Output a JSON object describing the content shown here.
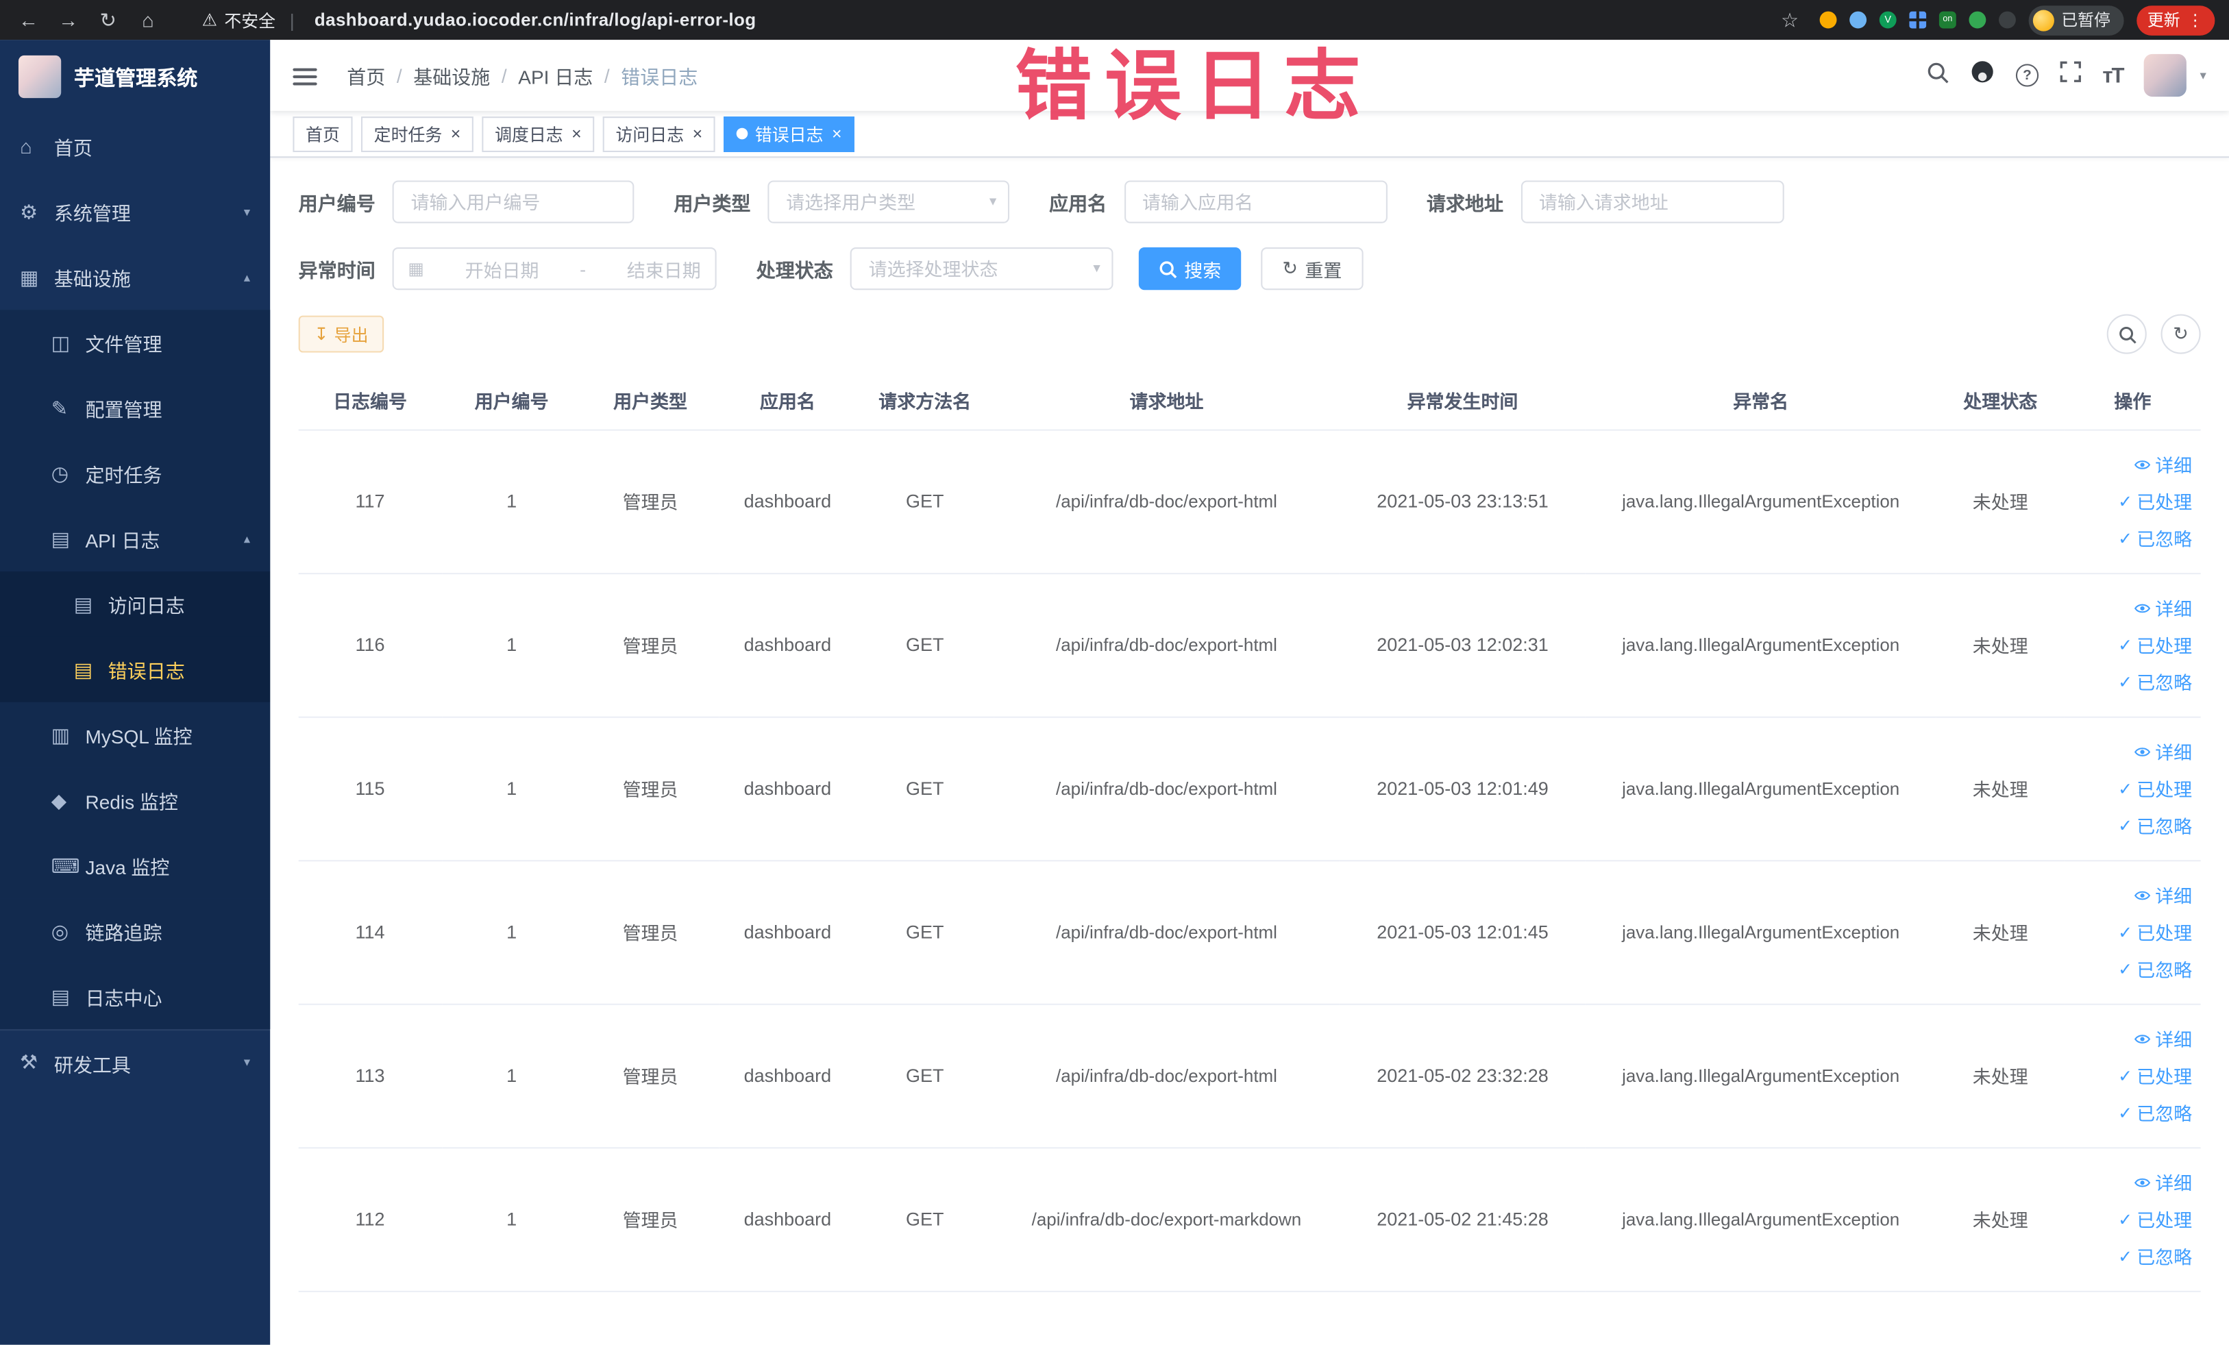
{
  "colors": {
    "accent": "#409eff",
    "warning_button": "#e6a23c",
    "annotation_red": "#ea3f5f",
    "sidebar_active": "#ffd15c",
    "active_tab": "#409eff"
  },
  "icons": {
    "back": "←",
    "forward": "→",
    "refresh": "↻",
    "home": "⌂",
    "warning": "⚠",
    "star": "☆",
    "more": "⋮",
    "close": "×",
    "chevron_down": "▾",
    "chevron_up": "▴",
    "caret": "▾",
    "check": "✓",
    "calendar": "▦",
    "export": "↧",
    "grid": "▦",
    "ext_v": "V",
    "ext_on": "on"
  },
  "browser": {
    "security_label": "不安全",
    "url": "dashboard.yudao.iocoder.cn/infra/log/api-error-log",
    "profile_chip": "已暂停",
    "update_label": "更新"
  },
  "sidebar": {
    "title": "芋道管理系统",
    "items": [
      {
        "glyph": "⌂",
        "label": "首页"
      },
      {
        "glyph": "⚙",
        "label": "系统管理"
      },
      {
        "glyph": "▦",
        "label": "基础设施"
      },
      {
        "glyph": "◫",
        "label": "文件管理"
      },
      {
        "glyph": "✎",
        "label": "配置管理"
      },
      {
        "glyph": "◷",
        "label": "定时任务"
      },
      {
        "glyph": "▤",
        "label": "API 日志"
      },
      {
        "glyph": "▤",
        "label": "访问日志"
      },
      {
        "glyph": "▤",
        "label": "错误日志"
      },
      {
        "glyph": "▥",
        "label": "MySQL 监控"
      },
      {
        "glyph": "◆",
        "label": "Redis 监控"
      },
      {
        "glyph": "⌨",
        "label": "Java 监控"
      },
      {
        "glyph": "◎",
        "label": "链路追踪"
      },
      {
        "glyph": "▤",
        "label": "日志中心"
      },
      {
        "glyph": "⚒",
        "label": "研发工具"
      }
    ]
  },
  "header": {
    "breadcrumb": [
      "首页",
      "基础设施",
      "API 日志",
      "错误日志"
    ],
    "separator": "/"
  },
  "annotation": "错误日志",
  "tabs": [
    {
      "label": "首页"
    },
    {
      "label": "定时任务"
    },
    {
      "label": "调度日志"
    },
    {
      "label": "访问日志"
    },
    {
      "label": "错误日志"
    }
  ],
  "filters": {
    "user_id_label": "用户编号",
    "user_id_placeholder": "请输入用户编号",
    "user_type_label": "用户类型",
    "user_type_placeholder": "请选择用户类型",
    "app_name_label": "应用名",
    "app_name_placeholder": "请输入应用名",
    "request_url_label": "请求地址",
    "request_url_placeholder": "请输入请求地址",
    "time_label": "异常时间",
    "time_start_placeholder": "开始日期",
    "time_separator": "-",
    "time_end_placeholder": "结束日期",
    "status_label": "处理状态",
    "status_placeholder": "请选择处理状态",
    "search_label": "搜索",
    "reset_label": "重置"
  },
  "toolbar": {
    "export_label": "导出"
  },
  "table": {
    "columns": [
      "日志编号",
      "用户编号",
      "用户类型",
      "应用名",
      "请求方法名",
      "请求地址",
      "异常发生时间",
      "异常名",
      "处理状态",
      "操作"
    ],
    "actions": {
      "detail": "详细",
      "processed": "已处理",
      "ignored": "已忽略"
    },
    "rows": [
      {
        "id": "117",
        "user_id": "1",
        "user_type": "管理员",
        "app": "dashboard",
        "method": "GET",
        "url": "/api/infra/db-doc/export-html",
        "time": "2021-05-03 23:13:51",
        "exception": "java.lang.IllegalArgumentException",
        "status": "未处理"
      },
      {
        "id": "116",
        "user_id": "1",
        "user_type": "管理员",
        "app": "dashboard",
        "method": "GET",
        "url": "/api/infra/db-doc/export-html",
        "time": "2021-05-03 12:02:31",
        "exception": "java.lang.IllegalArgumentException",
        "status": "未处理"
      },
      {
        "id": "115",
        "user_id": "1",
        "user_type": "管理员",
        "app": "dashboard",
        "method": "GET",
        "url": "/api/infra/db-doc/export-html",
        "time": "2021-05-03 12:01:49",
        "exception": "java.lang.IllegalArgumentException",
        "status": "未处理"
      },
      {
        "id": "114",
        "user_id": "1",
        "user_type": "管理员",
        "app": "dashboard",
        "method": "GET",
        "url": "/api/infra/db-doc/export-html",
        "time": "2021-05-03 12:01:45",
        "exception": "java.lang.IllegalArgumentException",
        "status": "未处理"
      },
      {
        "id": "113",
        "user_id": "1",
        "user_type": "管理员",
        "app": "dashboard",
        "method": "GET",
        "url": "/api/infra/db-doc/export-html",
        "time": "2021-05-02 23:32:28",
        "exception": "java.lang.IllegalArgumentException",
        "status": "未处理"
      },
      {
        "id": "112",
        "user_id": "1",
        "user_type": "管理员",
        "app": "dashboard",
        "method": "GET",
        "url": "/api/infra/db-doc/export-markdown",
        "time": "2021-05-02 21:45:28",
        "exception": "java.lang.IllegalArgumentException",
        "status": "未处理"
      }
    ]
  }
}
